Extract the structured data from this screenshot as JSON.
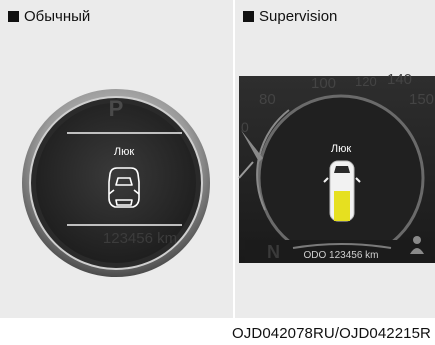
{
  "panels": [
    {
      "heading": "Обычный",
      "warning_label": "Люк",
      "gear_indicator": "P",
      "odometer_text": "123456 km"
    },
    {
      "heading": "Supervision",
      "warning_label": "Люк",
      "speed_scale": [
        "80",
        "100",
        "120",
        "140",
        "150",
        "0"
      ],
      "gear_indicator": "N",
      "odometer_text": "ODO 123456 km"
    }
  ],
  "caption": "OJD042078RU/OJD042215R",
  "colors": {
    "open_hatch": "#e6e020",
    "display_bg": "#232323"
  },
  "icons": [
    "car-top-view-icon",
    "person-icon"
  ]
}
